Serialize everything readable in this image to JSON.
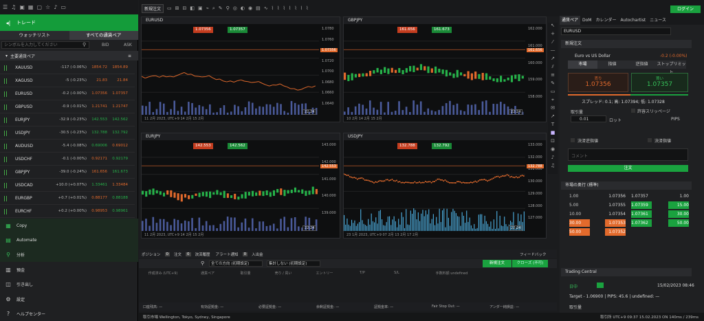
{
  "left": {
    "trade_label": "トレード",
    "tabs": [
      "ウォッチリスト",
      "すべての通貨ペア"
    ],
    "search_placeholder": "シンボルを入力してください",
    "col_bid": "BID",
    "col_ask": "ASK",
    "group": "主要通貨ペア",
    "rows": [
      {
        "sym": "XAUUSD",
        "chg": "-117 (-0.06%)",
        "bid": "1854.72",
        "ask": "1854.89",
        "bidc": "#e26a2c",
        "askc": "#e26a2c"
      },
      {
        "sym": "XAGUSD",
        "chg": "-5 (-0.23%)",
        "bid": "21.83",
        "ask": "21.84",
        "bidc": "#e26a2c",
        "askc": "#e26a2c"
      },
      {
        "sym": "EURUSD",
        "chg": "-0.2 (-0.00%)",
        "bid": "1.07356",
        "ask": "1.07357",
        "bidc": "#e26a2c",
        "askc": "#e26a2c"
      },
      {
        "sym": "GBPUSD",
        "chg": "-0.9 (-0.01%)",
        "bid": "1.21741",
        "ask": "1.21747",
        "bidc": "#e26a2c",
        "askc": "#e26a2c"
      },
      {
        "sym": "EURJPY",
        "chg": "-32.9 (-0.23%)",
        "bid": "142.553",
        "ask": "142.562",
        "bidc": "#26b34a",
        "askc": "#26b34a"
      },
      {
        "sym": "USDJPY",
        "chg": "-30.5 (-0.23%)",
        "bid": "132.788",
        "ask": "132.792",
        "bidc": "#26b34a",
        "askc": "#26b34a"
      },
      {
        "sym": "AUDUSD",
        "chg": "-5.4 (-0.08%)",
        "bid": "0.69006",
        "ask": "0.69012",
        "bidc": "#26b34a",
        "askc": "#e26a2c"
      },
      {
        "sym": "USDCHF",
        "chg": "-0.1 (-0.00%)",
        "bid": "0.92171",
        "ask": "0.92179",
        "bidc": "#e26a2c",
        "askc": "#26b34a"
      },
      {
        "sym": "GBPJPY",
        "chg": "-39.0 (-0.24%)",
        "bid": "161.656",
        "ask": "161.673",
        "bidc": "#e26a2c",
        "askc": "#26b34a"
      },
      {
        "sym": "USDCAD",
        "chg": "+10.0 (+0.07%)",
        "bid": "1.33461",
        "ask": "1.33484",
        "bidc": "#26b34a",
        "askc": "#e26a2c"
      },
      {
        "sym": "EURGBP",
        "chg": "+0.7 (+0.01%)",
        "bid": "0.88177",
        "ask": "0.88188",
        "bidc": "#e26a2c",
        "askc": "#26b34a"
      },
      {
        "sym": "EURCHF",
        "chg": "+0.2 (+0.00%)",
        "bid": "0.98953",
        "ask": "0.98961",
        "bidc": "#e26a2c",
        "askc": "#26b34a"
      }
    ],
    "menu": [
      {
        "icon": "▦",
        "label": "Copy"
      },
      {
        "icon": "▤",
        "label": "Automate"
      },
      {
        "icon": "⚲",
        "label": "分析"
      },
      {
        "icon": "▥",
        "label": "預金"
      },
      {
        "icon": "◫",
        "label": "引き出し"
      },
      {
        "icon": "⚙",
        "label": "設定"
      },
      {
        "icon": "?",
        "label": "ヘルプセンター"
      }
    ]
  },
  "toolbar": {
    "new_order": "新規注文",
    "login": "ログイン"
  },
  "charts": [
    {
      "sym": "EURUSD",
      "sell": "1.07356",
      "buy": "1.07357",
      "dates": "11 2月 2023, UTC+9   14 2月   15 2月",
      "time": "22:24",
      "axis": [
        "1.0780",
        "1.0760",
        "1.0740",
        "1.0720",
        "1.0700",
        "1.0680",
        "1.0660",
        "1.0640"
      ],
      "price": "1.07356"
    },
    {
      "sym": "GBPJPY",
      "sell": "161.656",
      "buy": "161.673",
      "dates": "10 2月   14 2月   15 2月",
      "time": "22:24",
      "axis": [
        "162.000",
        "161.000",
        "160.000",
        "159.000",
        "158.000"
      ],
      "price": "161.656"
    },
    {
      "sym": "EURJPY",
      "sell": "142.553",
      "buy": "142.562",
      "dates": "11 2月 2023, UTC+9   14 2月   15 2月",
      "time": "22:24",
      "axis": [
        "143.000",
        "142.000",
        "141.000",
        "140.000",
        "139.000"
      ],
      "price": "142.553"
    },
    {
      "sym": "USDJPY",
      "sell": "132.788",
      "buy": "132.792",
      "dates": "23 1月 2023, UTC+9   07 2月   13 2月   17 2月",
      "time": "22:24",
      "axis": [
        "133.000",
        "132.000",
        "131.000",
        "130.000",
        "129.000",
        "128.000",
        "127.000"
      ],
      "price": "132.788"
    }
  ],
  "positions": {
    "tabs": [
      "ポジション",
      "注文",
      "決済履歴",
      "アラート通知",
      "入出金"
    ],
    "counts": [
      "0",
      "0",
      "",
      "0",
      ""
    ],
    "feedback": "フィードバック",
    "filter1": "全ての方向 (初期設定)",
    "filter2": "集計しない (初期設定)",
    "new_order": "新規注文",
    "close_all": "クローズ (不可)",
    "headers": [
      "作成済み (UTC+9)",
      "通貨ペア",
      "取引量",
      "売り / 買い",
      "エントリー",
      "T/P",
      "S/L",
      "手数料額 undefined"
    ],
    "footer": [
      "口座残高: —",
      "有効証拠金: —",
      "必要証拠金: —",
      "余剰証拠金: —",
      "証拠金率: —",
      "Fair Stop Out: —",
      "アンダー純損益: —"
    ]
  },
  "status": {
    "sessions": "取引市場 Wellington, Tokyo, Sydney, Singapore",
    "right": "取引所   UTC+9   09:37 15.02.2023   ON   140ms / 239ms"
  },
  "right": {
    "tabs": [
      "通貨ペア",
      "DoM",
      "カレンダー",
      "Autochartist",
      "ニュース"
    ],
    "symbol": "EURUSD",
    "order_title": "新規注文",
    "pair_name": "Euro vs US Dollar",
    "pair_chg": "-0.2 (-0.00%)",
    "order_types": [
      "市場",
      "指値",
      "逆指値",
      "ストップリミット"
    ],
    "sell_label": "売り",
    "sell_price": "1.07356",
    "buy_label": "買い",
    "buy_price": "1.07357",
    "spread": "スプレッド: 0.1; 高: 1.07394; 低: 1.07328",
    "volume_label": "取引量",
    "volume_value": "0.01",
    "lot": "ロット",
    "slippage": "許容スリッページ",
    "pips": "PIPS",
    "tp": "決済逆指値",
    "sl": "決済指値",
    "comment": "コメント",
    "order_btn": "注文",
    "depth_title": "市場の奥行 (標準)",
    "depth_left": [
      [
        "1.00",
        "1.07356"
      ],
      [
        "5.00",
        "1.07355"
      ],
      [
        "10.00",
        "1.07354"
      ],
      [
        "30.00",
        "1.07353"
      ],
      [
        "50.00",
        "1.07352"
      ]
    ],
    "depth_right": [
      [
        "1.07357",
        "1.00"
      ],
      [
        "1.07359",
        "15.00"
      ],
      [
        "1.07361",
        "30.00"
      ],
      [
        "1.07362",
        "50.00"
      ]
    ],
    "tc_title": "Trading Central",
    "tc_tag": "日中",
    "tc_date": "15/02/2023 08:46",
    "tc_target": "Target - 1.06900 | PIPS: 45.6 | undefined: —",
    "tc_vol": "取引量"
  }
}
